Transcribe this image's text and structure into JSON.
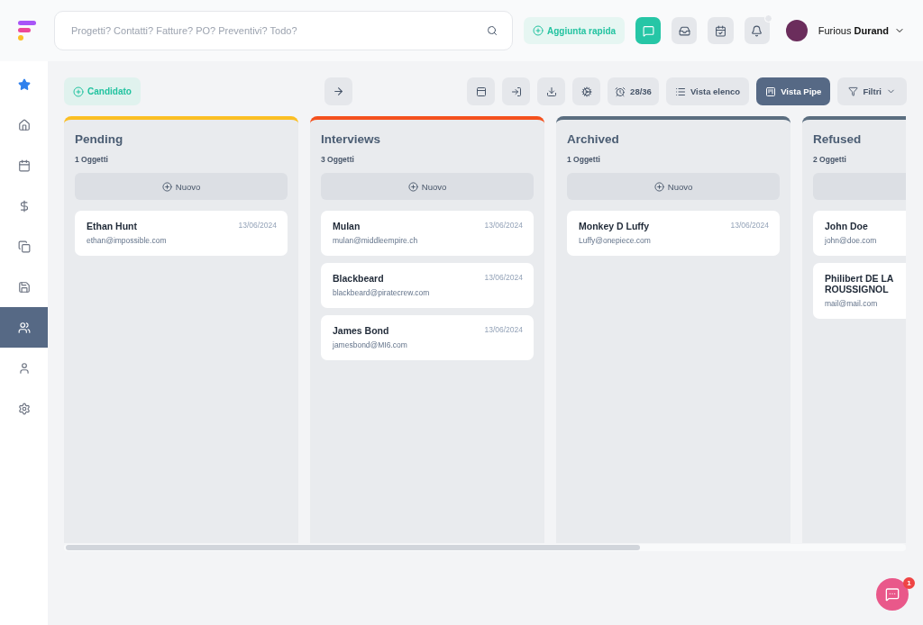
{
  "header": {
    "search": {
      "placeholder": "Progetti? Contatti? Fatture? PO? Preventivi? Todo?"
    },
    "quick_add": "Aggiunta rapida",
    "notification_unread": true,
    "user": {
      "name": "Furious **Durand**"
    }
  },
  "sidebar": {
    "items": [
      {
        "selected": false
      },
      {
        "selected": false
      },
      {
        "selected": false
      },
      {
        "selected": false
      },
      {
        "selected": false
      },
      {
        "selected": false
      },
      {
        "selected": true
      },
      {
        "selected": false
      },
      {
        "selected": false
      }
    ]
  },
  "toolbar": {
    "add_button": "Candidato",
    "counter": "28/36",
    "views": [
      {
        "label": "Vista elenco",
        "selected": false
      },
      {
        "label": "Vista Pipe",
        "selected": true
      }
    ],
    "filter": "Filtri"
  },
  "columns": [
    {
      "title": "Pending",
      "count": "1 Oggetti",
      "color": "#fbbf24",
      "new_label": "Nuovo",
      "cards": [
        {
          "name": "Ethan Hunt",
          "email": "ethan@impossible.com",
          "date": "13/06/2024"
        }
      ]
    },
    {
      "title": "Interviews",
      "count": "3 Oggetti",
      "color": "#f4511e",
      "new_label": "Nuovo",
      "cards": [
        {
          "name": "Mulan",
          "email": "mulan@middleempire.ch",
          "date": "13/06/2024"
        },
        {
          "name": "Blackbeard",
          "email": "blackbeard@piratecrew.com",
          "date": "13/06/2024"
        },
        {
          "name": "James Bond",
          "email": "jamesbond@MI6.com",
          "date": "13/06/2024"
        }
      ]
    },
    {
      "title": "Archived",
      "count": "1 Oggetti",
      "color": "#5b6e80",
      "new_label": "Nuovo",
      "cards": [
        {
          "name": "Monkey D Luffy",
          "email": "Luffy@onepiece.com",
          "date": "13/06/2024"
        }
      ]
    },
    {
      "title": "Refused",
      "count": "2 Oggetti",
      "color": "#5b6e80",
      "cards": [
        {
          "name": "John Doe",
          "email": "john@doe.com"
        },
        {
          "name": "Philibert DE LA ROUSSIGNOL",
          "email": "mail@mail.com"
        }
      ]
    }
  ],
  "chat": {
    "badge": "1"
  }
}
